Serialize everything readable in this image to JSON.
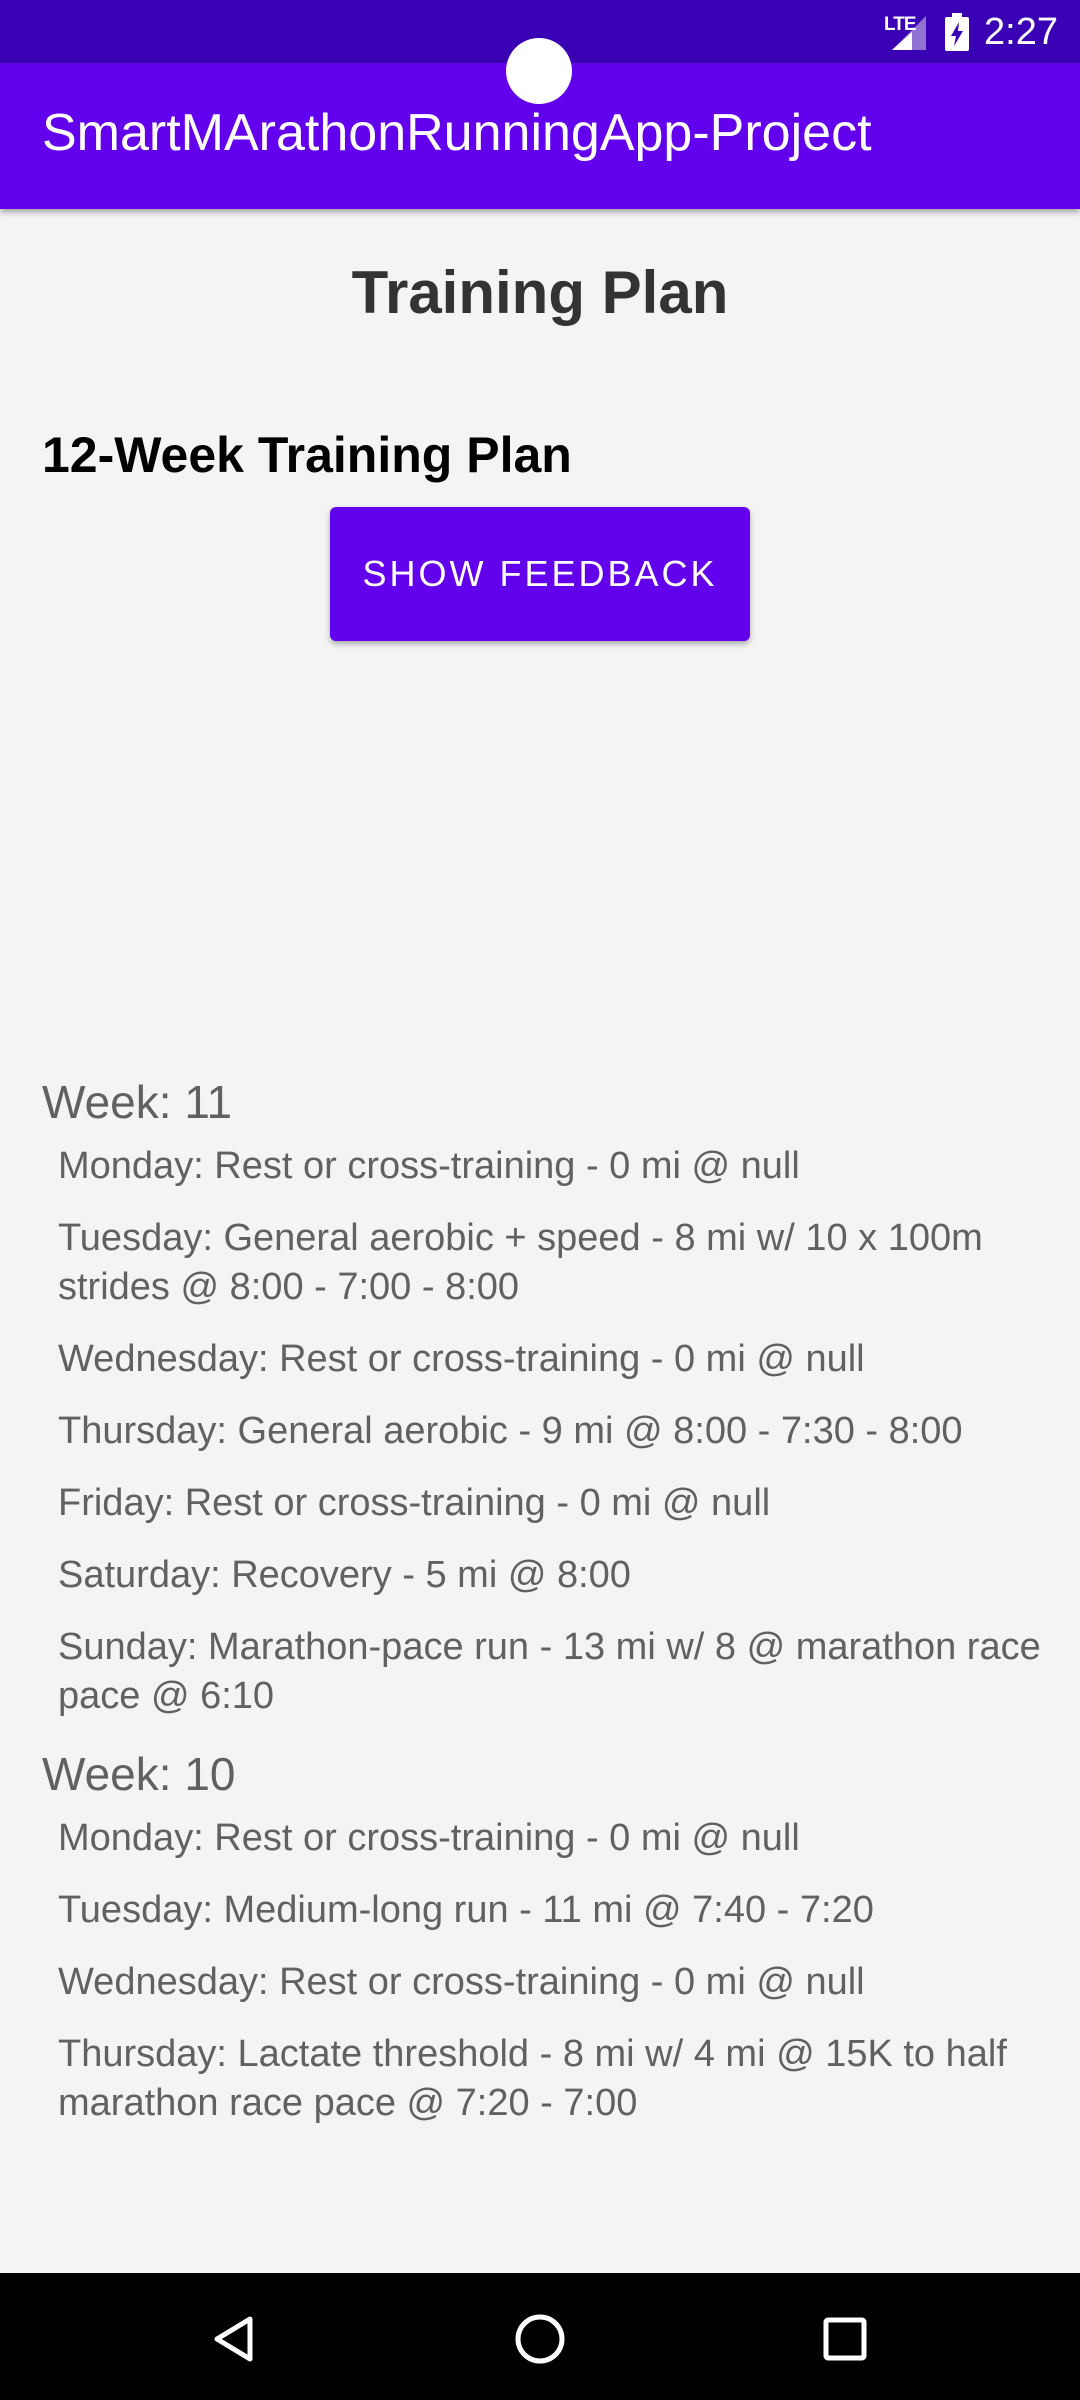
{
  "status_bar": {
    "network": "LTE",
    "time": "2:27"
  },
  "app_bar": {
    "title": "SmartMArathonRunningApp-Project"
  },
  "page": {
    "title": "Training Plan",
    "section_heading": "12-Week Training Plan",
    "feedback_button_label": "SHOW FEEDBACK"
  },
  "weeks": [
    {
      "title": "Week: 11",
      "days": [
        "Monday: Rest or cross-training - 0 mi @ null",
        "Tuesday: General aerobic + speed - 8 mi w/ 10 x 100m strides @ 8:00 - 7:00 - 8:00",
        "Wednesday: Rest or cross-training - 0 mi @ null",
        "Thursday: General aerobic - 9 mi @ 8:00 - 7:30 - 8:00",
        "Friday: Rest or cross-training - 0 mi @ null",
        "Saturday: Recovery - 5 mi @ 8:00",
        "Sunday: Marathon-pace run - 13 mi w/ 8 @ marathon race pace @ 6:10"
      ]
    },
    {
      "title": "Week: 10",
      "days": [
        "Monday: Rest or cross-training - 0 mi @ null",
        "Tuesday: Medium-long run - 11 mi @ 7:40 - 7:20",
        "Wednesday: Rest or cross-training - 0 mi @ null",
        "Thursday: Lactate threshold - 8 mi w/ 4 mi @ 15K to half marathon race pace @ 7:20 - 7:00"
      ]
    }
  ],
  "nav_bar": {
    "back_icon": "back-triangle-icon",
    "home_icon": "home-circle-icon",
    "recents_icon": "recents-square-icon"
  },
  "colors": {
    "status_bar": "#3a00b3",
    "primary": "#6200ee",
    "background": "#f4f4f4",
    "plan_text": "#616161"
  }
}
